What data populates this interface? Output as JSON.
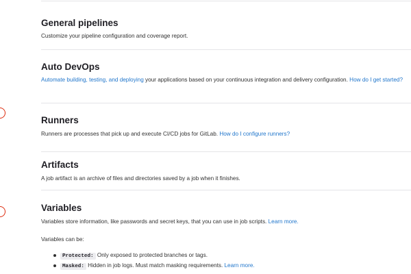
{
  "sections": {
    "general": {
      "title": "General pipelines",
      "description": "Customize your pipeline configuration and coverage report."
    },
    "autodevops": {
      "title": "Auto DevOps",
      "link_text": "Automate building, testing, and deploying",
      "description": " your applications based on your continuous integration and delivery configuration. ",
      "help_link": "How do I get started?"
    },
    "runners": {
      "title": "Runners",
      "description": "Runners are processes that pick up and execute CI/CD jobs for GitLab. ",
      "help_link": "How do I configure runners?"
    },
    "artifacts": {
      "title": "Artifacts",
      "description": "A job artifact is an archive of files and directories saved by a job when it finishes."
    },
    "variables": {
      "title": "Variables",
      "description": "Variables store information, like passwords and secret keys, that you can use in job scripts. ",
      "learn_more": "Learn more.",
      "can_be": "Variables can be:",
      "items": [
        {
          "keyword": "Protected:",
          "text": " Only exposed to protected branches or tags.",
          "link": ""
        },
        {
          "keyword": "Masked:",
          "text": " Hidden in job logs. Must match masking requirements. ",
          "link": "Learn more."
        }
      ]
    }
  },
  "colors": {
    "link": "#1f75cb",
    "marker": "#dd2b0e",
    "divider": "#e4e4e7"
  }
}
